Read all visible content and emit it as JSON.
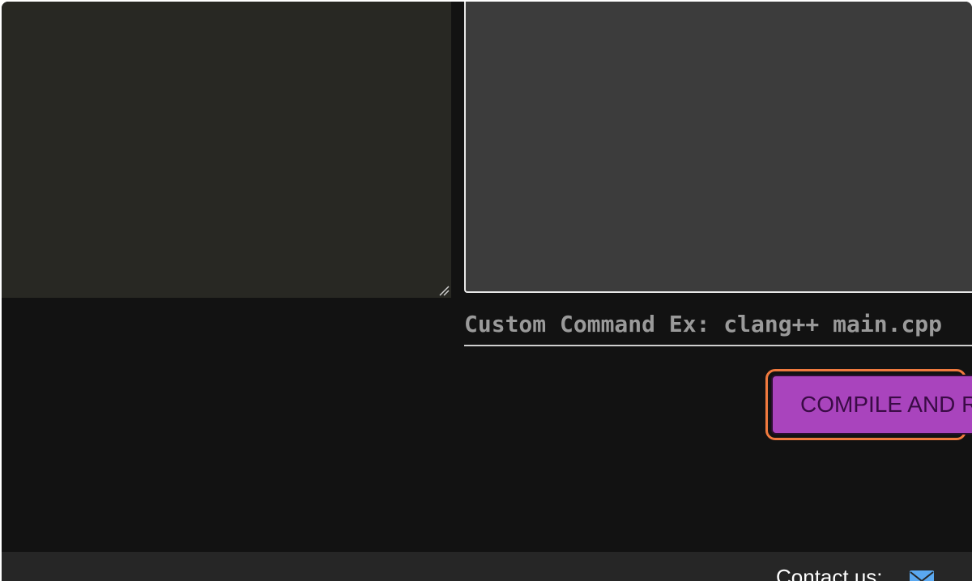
{
  "command": {
    "placeholder": "Custom Command Ex: clang++ main.cpp"
  },
  "actions": {
    "compile_label": "COMPILE AND RUN"
  },
  "footer": {
    "contact_label": "Contact us:"
  },
  "icons": {
    "resize": "resize-grip-icon",
    "mail": "envelope-icon"
  },
  "colors": {
    "editor_bg": "#282823",
    "output_bg": "#3c3c3c",
    "page_bg": "#121212",
    "compile_button": "#a944bd",
    "focus_ring": "#f07a3e",
    "mail_icon": "#5aa8f0"
  }
}
